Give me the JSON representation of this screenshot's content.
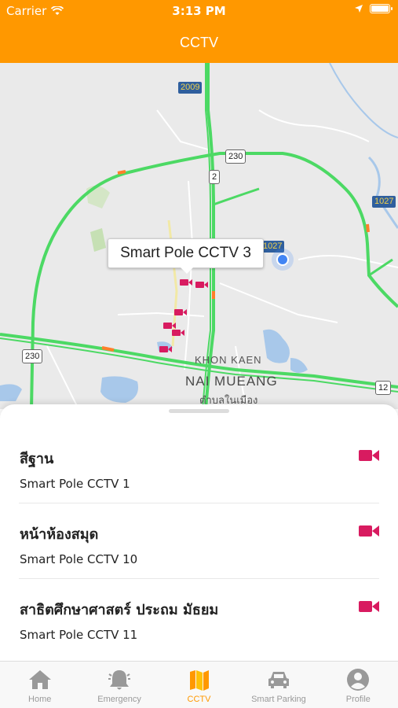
{
  "status": {
    "carrier": "Carrier",
    "time": "3:13 PM"
  },
  "header": {
    "title": "CCTV"
  },
  "map": {
    "road_shields": [
      "2009",
      "230",
      "2",
      "1027",
      "230",
      "12",
      "1027"
    ],
    "labels": {
      "khon_kaen": "KHON KAEN",
      "nai_mueang": "NAI MUEANG",
      "thai_district": "ตำบลในเมือง"
    },
    "callout": "Smart Pole CCTV 3"
  },
  "cameras": [
    {
      "name": "สีฐาน",
      "sub": "Smart Pole CCTV 1"
    },
    {
      "name": "หน้าห้องสมุด",
      "sub": "Smart Pole CCTV 10"
    },
    {
      "name": "สาธิตศึกษาศาสตร์ ประถม มัธยม",
      "sub": "Smart Pole CCTV 11"
    }
  ],
  "tabs": [
    {
      "label": "Home",
      "icon": "home-icon"
    },
    {
      "label": "Emergency",
      "icon": "bell-icon"
    },
    {
      "label": "CCTV",
      "icon": "map-icon"
    },
    {
      "label": "Smart Parking",
      "icon": "car-icon"
    },
    {
      "label": "Profile",
      "icon": "profile-icon"
    }
  ],
  "colors": {
    "accent": "#ff9800",
    "camera": "#d81b60",
    "road_green": "#4cd964",
    "user_location": "#4285f4",
    "tab_inactive": "#999999"
  }
}
